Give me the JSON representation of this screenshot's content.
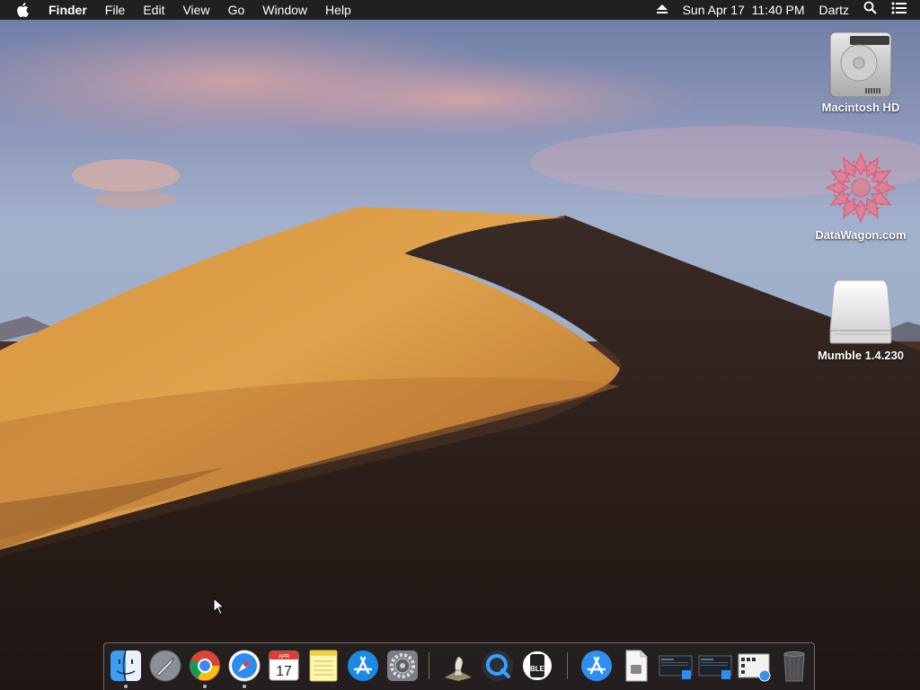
{
  "menubar": {
    "app_name": "Finder",
    "menus": [
      "File",
      "Edit",
      "View",
      "Go",
      "Window",
      "Help"
    ],
    "status": {
      "eject_icon": "eject-icon",
      "datetime": "Sun Apr 17  11:40 PM",
      "user": "Dartz",
      "search_icon": "spotlight-icon",
      "notifications_icon": "notification-center-icon"
    }
  },
  "desktop": {
    "icons": [
      {
        "label": "Macintosh HD",
        "icon": "hard-drive-icon"
      },
      {
        "label": "DataWagon.com",
        "icon": "mandala-icon"
      },
      {
        "label": "Mumble 1.4.230",
        "icon": "disk-image-icon"
      }
    ]
  },
  "dock": {
    "items": [
      {
        "name": "Finder",
        "icon": "finder-icon",
        "running": true
      },
      {
        "name": "Launchpad",
        "icon": "launchpad-icon",
        "running": false
      },
      {
        "name": "Google Chrome",
        "icon": "chrome-icon",
        "running": true
      },
      {
        "name": "Safari",
        "icon": "safari-icon",
        "running": true
      },
      {
        "name": "Calendar",
        "icon": "calendar-icon",
        "running": false,
        "month": "APR",
        "day": "17"
      },
      {
        "name": "Notes",
        "icon": "notes-icon",
        "running": false
      },
      {
        "name": "App Store",
        "icon": "app-store-icon",
        "running": false
      },
      {
        "name": "System Preferences",
        "icon": "system-preferences-icon",
        "running": false
      },
      {
        "name": "Chess",
        "icon": "chess-icon",
        "running": false
      },
      {
        "name": "QuickTime Player",
        "icon": "quicktime-icon",
        "running": false
      },
      {
        "name": "BLE",
        "icon": "ble-icon",
        "running": false,
        "text": "BLE"
      },
      {
        "name": "Applications",
        "icon": "applications-folder-icon",
        "running": false
      },
      {
        "name": "Document",
        "icon": "document-icon",
        "running": false
      },
      {
        "name": "Screenshot 1",
        "icon": "screenshot-icon",
        "running": false
      },
      {
        "name": "Screenshot 2",
        "icon": "screenshot-icon",
        "running": false
      },
      {
        "name": "Downloads",
        "icon": "downloads-stack-icon",
        "running": false
      },
      {
        "name": "Trash",
        "icon": "trash-icon",
        "running": false
      }
    ]
  },
  "colors": {
    "menubar_bg": "#202020",
    "dune_light": "#e0a04a",
    "dune_shadow": "#2a1d18"
  }
}
